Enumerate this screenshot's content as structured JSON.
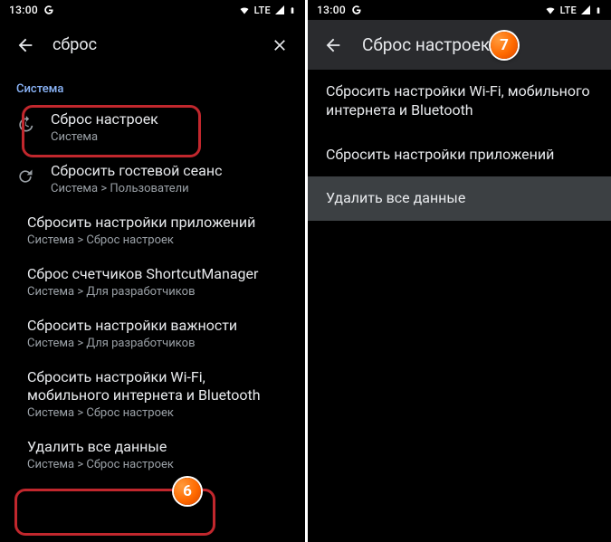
{
  "status": {
    "time": "13:00",
    "network": "LTE"
  },
  "left": {
    "search_value": "сброс",
    "section": "Система",
    "results": [
      {
        "title": "Сброс настроек",
        "sub": "Система",
        "icon": "history"
      },
      {
        "title": "Сбросить гостевой сеанс",
        "sub": "Система > Пользователи",
        "icon": "refresh"
      },
      {
        "title": "Сбросить настройки приложений",
        "sub": "Система > Сброс настроек"
      },
      {
        "title": "Сброс счетчиков ShortcutManager",
        "sub": "Система > Для разработчиков"
      },
      {
        "title": "Сбросить настройки важности",
        "sub": "Система > Для разработчиков"
      },
      {
        "title": "Сбросить настройки Wi-Fi, мобильного интернета и Bluetooth",
        "sub": "Система > Сброс настроек"
      },
      {
        "title": "Удалить все данные",
        "sub": "Система > Сброс настроек"
      }
    ]
  },
  "right": {
    "title": "Сброс настроек",
    "items": [
      "Сбросить настройки Wi-Fi, мобильного интернета и Bluetooth",
      "Сбросить настройки приложений",
      "Удалить все данные"
    ]
  },
  "badges": {
    "b6": "6",
    "b7": "7"
  }
}
